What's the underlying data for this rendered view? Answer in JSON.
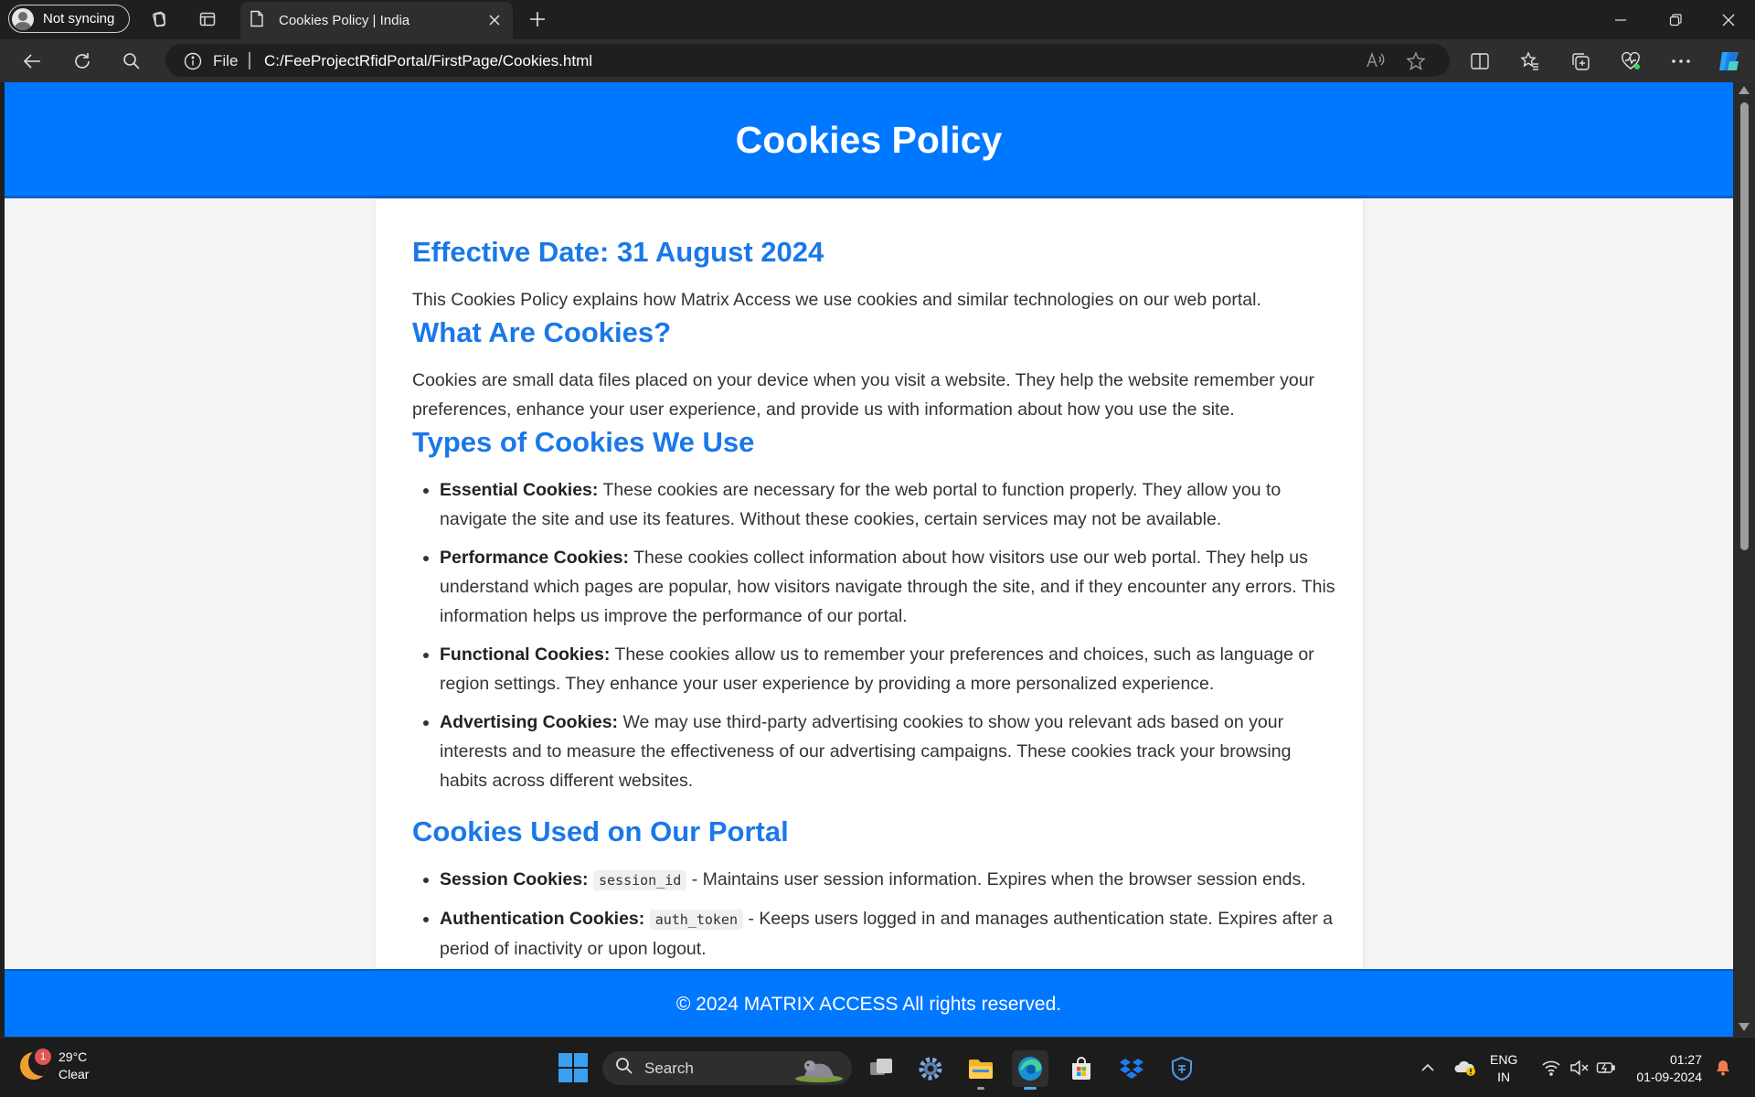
{
  "browser": {
    "profile_label": "Not syncing",
    "tab_title": "Cookies Policy | India",
    "address_scheme_label": "File",
    "url": "C:/FeeProjectRfidPortal/FirstPage/Cookies.html"
  },
  "page": {
    "header_title": "Cookies Policy",
    "effective_date_heading": "Effective Date: 31 August 2024",
    "intro": "This Cookies Policy explains how Matrix Access we use cookies and similar technologies on our web portal.",
    "what_heading": "What Are Cookies?",
    "what_text": "Cookies are small data files placed on your device when you visit a website. They help the website remember your preferences, enhance your user experience, and provide us with information about how you use the site.",
    "types_heading": "Types of Cookies We Use",
    "types": [
      {
        "title": "Essential Cookies:",
        "text": " These cookies are necessary for the web portal to function properly. They allow you to navigate the site and use its features. Without these cookies, certain services may not be available."
      },
      {
        "title": "Performance Cookies:",
        "text": " These cookies collect information about how visitors use our web portal. They help us understand which pages are popular, how visitors navigate through the site, and if they encounter any errors. This information helps us improve the performance of our portal."
      },
      {
        "title": "Functional Cookies:",
        "text": " These cookies allow us to remember your preferences and choices, such as language or region settings. They enhance your user experience by providing a more personalized experience."
      },
      {
        "title": "Advertising Cookies:",
        "text": " We may use third-party advertising cookies to show you relevant ads based on your interests and to measure the effectiveness of our advertising campaigns. These cookies track your browsing habits across different websites."
      }
    ],
    "used_heading": "Cookies Used on Our Portal",
    "used": [
      {
        "title": "Session Cookies:",
        "code": "session_id",
        "text": " - Maintains user session information. Expires when the browser session ends."
      },
      {
        "title": "Authentication Cookies:",
        "code": "auth_token",
        "text": " - Keeps users logged in and manages authentication state. Expires after a period of inactivity or upon logout."
      }
    ],
    "footer": "© 2024 MATRIX ACCESS All rights reserved."
  },
  "taskbar": {
    "weather_temp": "29°C",
    "weather_cond": "Clear",
    "weather_badge": "1",
    "search_label": "Search",
    "lang_top": "ENG",
    "lang_bottom": "IN",
    "time": "01:27",
    "date": "01-09-2024"
  },
  "colors": {
    "header_blue": "#0077ff",
    "heading_blue": "#1a78e8"
  }
}
